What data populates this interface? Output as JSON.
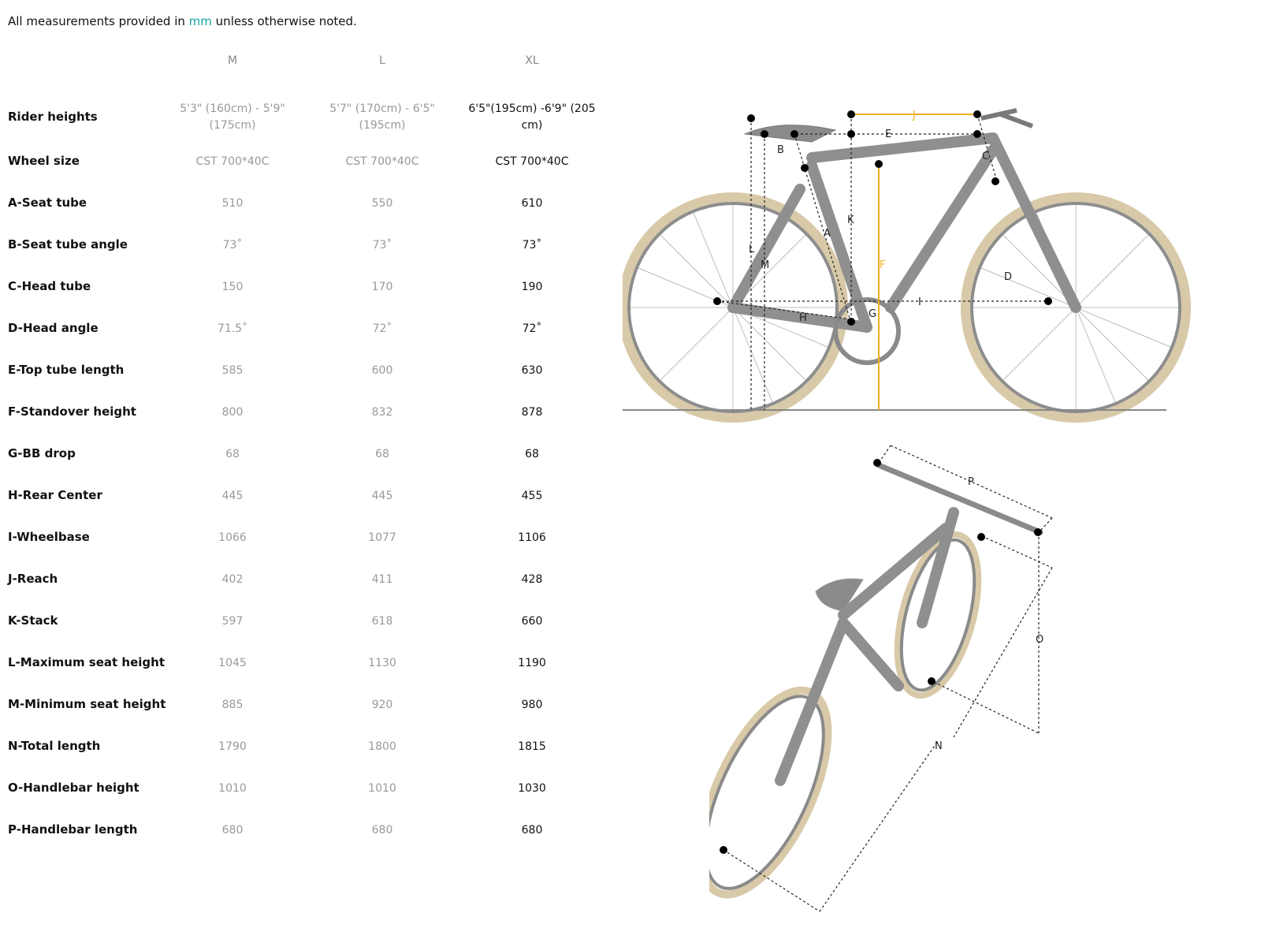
{
  "note": {
    "prefix": "All measurements provided in ",
    "unit": "mm",
    "suffix": " unless otherwise noted."
  },
  "sizes": [
    "M",
    "L",
    "XL"
  ],
  "rows": [
    {
      "label": "Rider heights",
      "values": [
        "5'3\" (160cm) - 5'9\"\n(175cm)",
        "5'7\" (170cm) - 6'5\"\n(195cm)",
        "6'5\"(195cm) -6'9\" (205\ncm)"
      ]
    },
    {
      "label": "Wheel size",
      "values": [
        "CST 700*40C",
        "CST 700*40C",
        "CST 700*40C"
      ]
    },
    {
      "label": "A-Seat tube",
      "values": [
        "510",
        "550",
        "610"
      ]
    },
    {
      "label": "B-Seat tube angle",
      "values": [
        "73˚",
        "73˚",
        "73˚"
      ]
    },
    {
      "label": "C-Head tube",
      "values": [
        "150",
        "170",
        "190"
      ]
    },
    {
      "label": "D-Head angle",
      "values": [
        "71.5˚",
        "72˚",
        "72˚"
      ]
    },
    {
      "label": "E-Top tube length",
      "values": [
        "585",
        "600",
        "630"
      ]
    },
    {
      "label": "F-Standover height",
      "values": [
        "800",
        "832",
        "878"
      ]
    },
    {
      "label": "G-BB drop",
      "values": [
        "68",
        "68",
        "68"
      ]
    },
    {
      "label": "H-Rear Center",
      "values": [
        "445",
        "445",
        "455"
      ]
    },
    {
      "label": "I-Wheelbase",
      "values": [
        "1066",
        "1077",
        "1106"
      ]
    },
    {
      "label": "J-Reach",
      "values": [
        "402",
        "411",
        "428"
      ]
    },
    {
      "label": "K-Stack",
      "values": [
        "597",
        "618",
        "660"
      ]
    },
    {
      "label": "L-Maximum seat height",
      "values": [
        "1045",
        "1130",
        "1190"
      ]
    },
    {
      "label": "M-Minimum seat height",
      "values": [
        "885",
        "920",
        "980"
      ]
    },
    {
      "label": "N-Total length",
      "values": [
        "1790",
        "1800",
        "1815"
      ]
    },
    {
      "label": "O-Handlebar height",
      "values": [
        "1010",
        "1010",
        "1030"
      ]
    },
    {
      "label": "P-Handlebar length",
      "values": [
        "680",
        "680",
        "680"
      ]
    }
  ],
  "diagram_side": {
    "letters": [
      "A",
      "B",
      "C",
      "D",
      "E",
      "F",
      "G",
      "H",
      "I",
      "J",
      "K",
      "L",
      "M"
    ]
  },
  "diagram_front": {
    "letters": [
      "N",
      "O",
      "P"
    ]
  },
  "colors": {
    "accent": "#1aa3a3",
    "dimension_highlight": "#f0b020",
    "bike": "#9a9a9a",
    "tire": "#d8c9a8"
  }
}
